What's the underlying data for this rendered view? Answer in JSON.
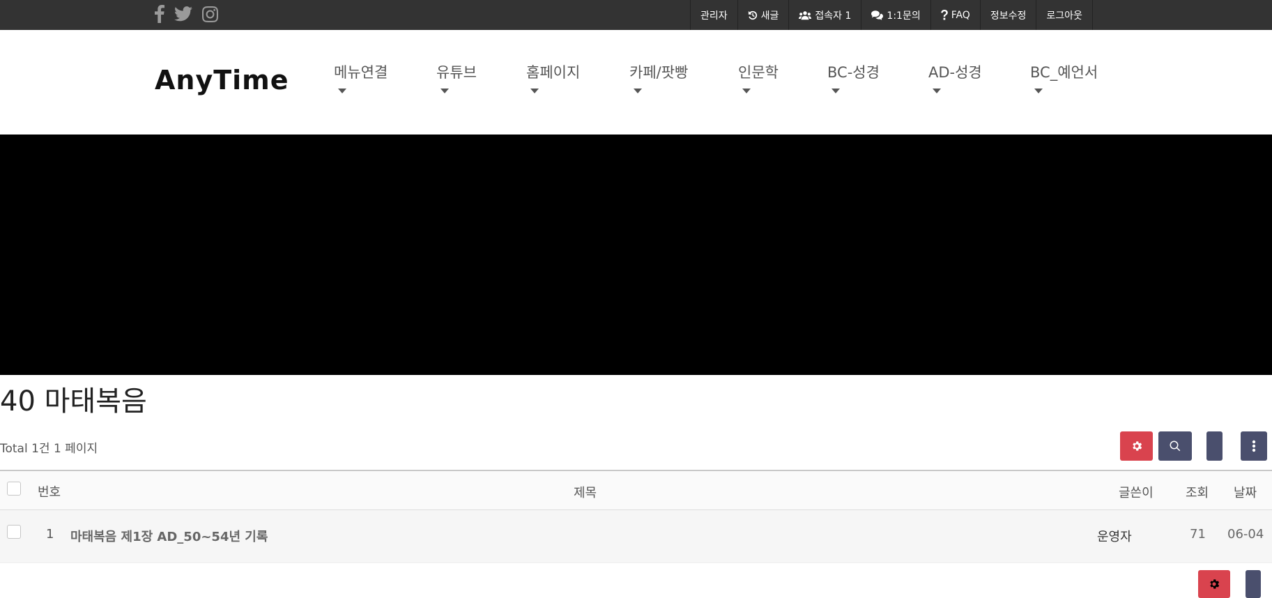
{
  "topbar": {
    "social": [
      "facebook-icon",
      "twitter-icon",
      "instagram-icon"
    ],
    "links": [
      {
        "label": "관리자",
        "icon": null,
        "name": "admin-link"
      },
      {
        "label": "새글",
        "icon": "history-icon",
        "name": "new-posts-link"
      },
      {
        "label": "접속자 1",
        "icon": "users-icon",
        "name": "visitors-link"
      },
      {
        "label": "1:1문의",
        "icon": "chat-icon",
        "name": "inquiry-link"
      },
      {
        "label": "FAQ",
        "icon": "question-icon",
        "name": "faq-link"
      },
      {
        "label": "정보수정",
        "icon": null,
        "name": "edit-profile-link"
      },
      {
        "label": "로그아웃",
        "icon": null,
        "name": "logout-link"
      }
    ]
  },
  "header": {
    "logo": "AnyTime",
    "nav": [
      "메뉴연결",
      "유튜브",
      "홈페이지",
      "카페/팟빵",
      "인문학",
      "BC-성경",
      "AD-성경",
      "BC_예언서"
    ]
  },
  "board": {
    "title": "40 마태복음",
    "total": "Total 1건 1 페이지",
    "columns": {
      "num": "번호",
      "subject": "제목",
      "writer": "글쓴이",
      "views": "조회",
      "date": "날짜"
    },
    "rows": [
      {
        "num": "1",
        "subject": "마태복음 제1장 AD_50~54년 기록",
        "writer": "운영자",
        "views": "71",
        "date": "06-04"
      }
    ]
  },
  "colors": {
    "topbar": "#333333",
    "red_button": "#d9434e",
    "navy_button": "#4a4f6d",
    "hero": "#000000"
  }
}
